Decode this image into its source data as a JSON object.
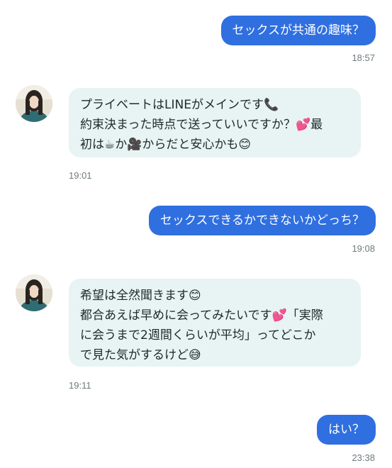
{
  "conversation": {
    "messages": [
      {
        "direction": "out",
        "text": "セックスが共通の趣味？",
        "time": "18:57"
      },
      {
        "direction": "in",
        "lines": [
          "プライベートはLINEがメインです📞",
          "約束決まった時点で送っていいですか？💕最",
          "初は☕か🎥からだと安心かも😊"
        ],
        "time": "19:01"
      },
      {
        "direction": "out",
        "text": "セックスできるかできないかどっち？",
        "time": "19:08"
      },
      {
        "direction": "in",
        "lines": [
          "希望は全然聞きます😊",
          "都合あえば早めに会ってみたいです💕「実際",
          "に会うまで2週間くらいが平均」ってどこか",
          "で見た気がするけど😅"
        ],
        "time": "19:11"
      },
      {
        "direction": "out",
        "text": "はい？",
        "time": "23:38"
      }
    ]
  },
  "colors": {
    "outgoing_bubble": "#2f6fe0",
    "incoming_bubble": "#e8f3f3",
    "timestamp": "#6f7a7d"
  }
}
